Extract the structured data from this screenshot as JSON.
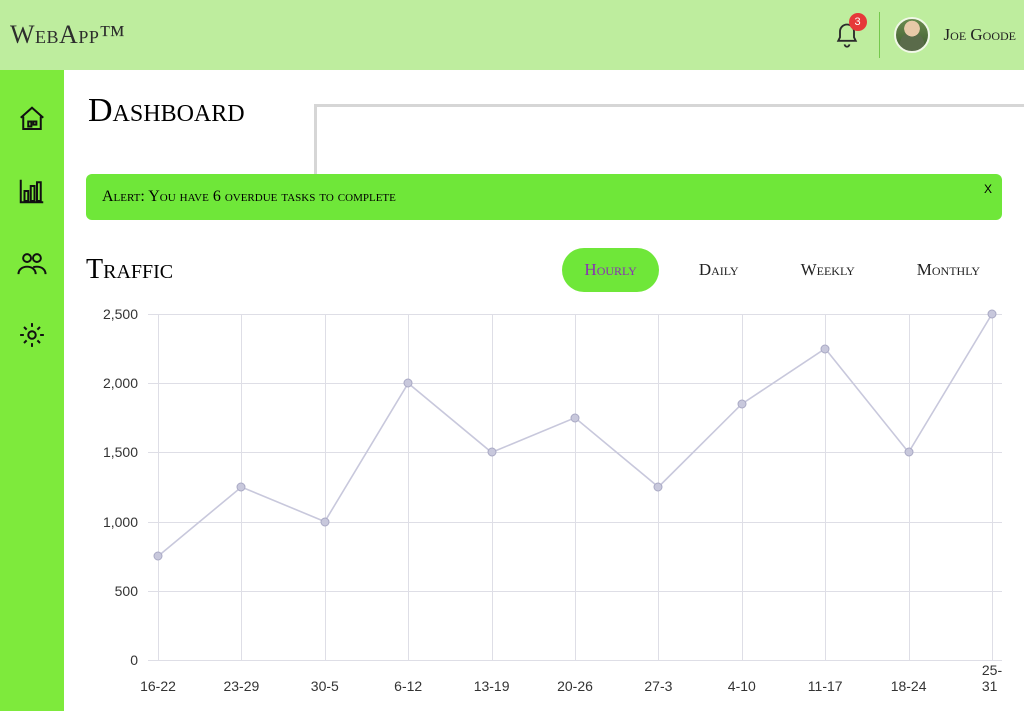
{
  "app_name": "WebApp™",
  "notifications": {
    "count": "3"
  },
  "user": {
    "name": "Joe Goode"
  },
  "sidebar": {
    "items": [
      {
        "name": "home",
        "icon": "home-icon"
      },
      {
        "name": "analytics",
        "icon": "bar-chart-icon"
      },
      {
        "name": "users",
        "icon": "users-icon"
      },
      {
        "name": "settings",
        "icon": "gear-icon"
      }
    ]
  },
  "page_title": "Dashboard",
  "alert": {
    "text": "Alert: You have 6 overdue tasks to complete",
    "close": "x"
  },
  "traffic": {
    "title": "Traffic",
    "tabs": [
      "Hourly",
      "Daily",
      "Weekly",
      "Monthly"
    ],
    "active_tab": 0
  },
  "chart_data": {
    "type": "line",
    "categories": [
      "16-22",
      "23-29",
      "30-5",
      "6-12",
      "13-19",
      "20-26",
      "27-3",
      "4-10",
      "11-17",
      "18-24",
      "25-31"
    ],
    "values": [
      750,
      1250,
      1000,
      2000,
      1500,
      1750,
      1250,
      1850,
      2250,
      1500,
      2500
    ],
    "ylabel": "",
    "xlabel": "",
    "ylim": [
      0,
      2500
    ],
    "yticks": [
      0,
      500,
      1000,
      1500,
      2000,
      2500
    ]
  },
  "colors": {
    "header": "#beed9e",
    "sidebar": "#7eea3c",
    "accent": "#6fe739",
    "active_tab_text": "#8a2fb5",
    "badge": "#e63939",
    "grid": "#dedee6",
    "line": "#c8c8dc"
  }
}
